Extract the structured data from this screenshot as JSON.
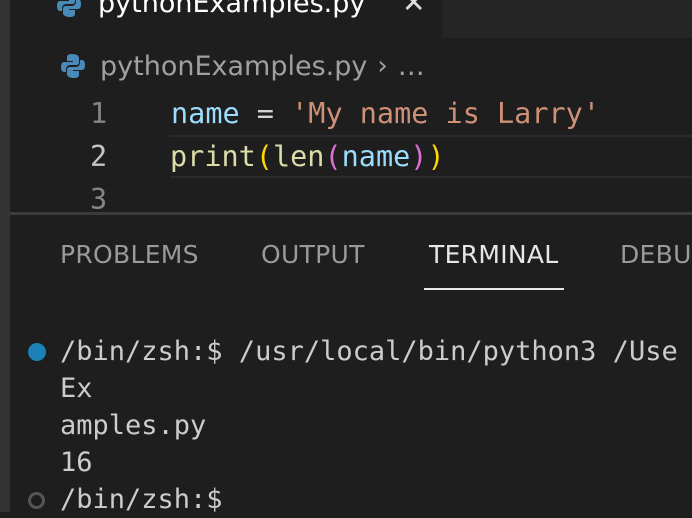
{
  "editor_tab": {
    "filename": "pythonExamples.py",
    "close_glyph": "✕"
  },
  "breadcrumb": {
    "file": "pythonExamples.py",
    "separator": "›",
    "more": "…"
  },
  "code": {
    "line_numbers": [
      "1",
      "2",
      "3"
    ],
    "line1": {
      "var": "name",
      "op": " = ",
      "str": "'My name is Larry'"
    },
    "line2": {
      "fn1": "print",
      "open1": "(",
      "fn2": "len",
      "open2": "(",
      "arg": "name",
      "close2": ")",
      "close1": ")"
    }
  },
  "panel_tabs": [
    "PROBLEMS",
    "OUTPUT",
    "TERMINAL",
    "DEBU"
  ],
  "active_panel_tab": "TERMINAL",
  "terminal": {
    "lines": [
      "/bin/zsh:$ /usr/local/bin/python3 /Use",
      "Ex",
      "amples.py",
      "16",
      "/bin/zsh:$"
    ]
  },
  "colors": {
    "accent_dot": "#1b81b8",
    "string": "#ce9178",
    "variable": "#9cdcfe",
    "function": "#dcdcaa"
  }
}
